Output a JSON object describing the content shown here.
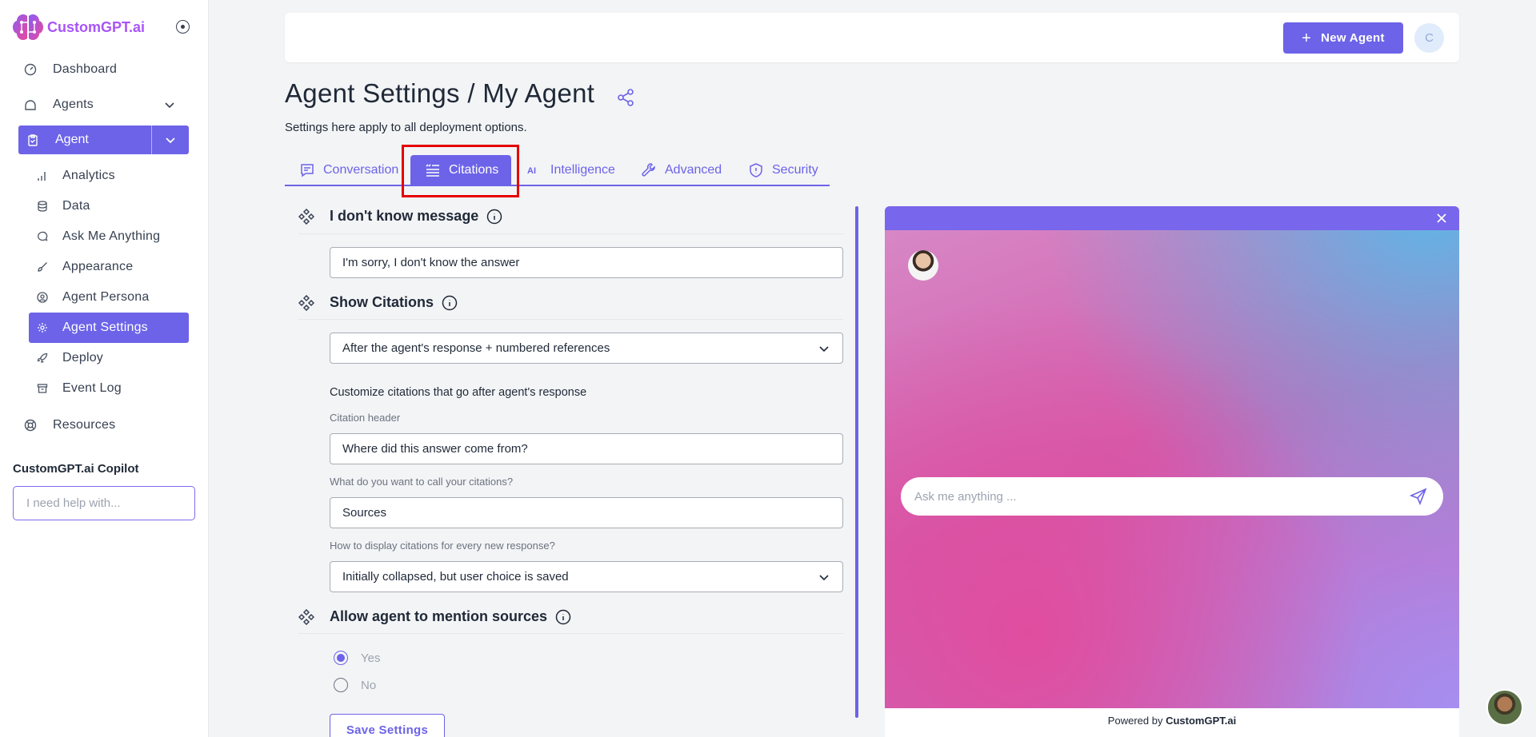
{
  "brand": {
    "name": "CustomGPT.ai",
    "accent": "#6c63e8"
  },
  "sidebar": {
    "items": [
      {
        "label": "Dashboard",
        "icon": "dashboard-icon"
      },
      {
        "label": "Agents",
        "icon": "home-icon"
      },
      {
        "label": "Agent",
        "icon": "clipboard-icon"
      }
    ],
    "sub_items": [
      {
        "label": "Analytics",
        "icon": "bar-chart-icon"
      },
      {
        "label": "Data",
        "icon": "database-icon"
      },
      {
        "label": "Ask Me Anything",
        "icon": "chat-icon"
      },
      {
        "label": "Appearance",
        "icon": "brush-icon"
      },
      {
        "label": "Agent Persona",
        "icon": "user-circle-icon"
      },
      {
        "label": "Agent Settings",
        "icon": "gear-icon",
        "active": true
      },
      {
        "label": "Deploy",
        "icon": "rocket-icon"
      },
      {
        "label": "Event Log",
        "icon": "archive-icon"
      }
    ],
    "resources": "Resources",
    "copilot": {
      "title": "CustomGPT.ai Copilot",
      "placeholder": "I need help with..."
    }
  },
  "header": {
    "new_agent": "New Agent",
    "avatar_initial": "C"
  },
  "page": {
    "title": "Agent Settings / My Agent",
    "subtitle": "Settings here apply to all deployment options."
  },
  "tabs": [
    {
      "label": "Conversation",
      "icon": "chat-icon"
    },
    {
      "label": "Citations",
      "icon": "list-quote-icon",
      "active": true
    },
    {
      "label": "Intelligence",
      "icon": "ai-icon"
    },
    {
      "label": "Advanced",
      "icon": "wrench-icon"
    },
    {
      "label": "Security",
      "icon": "shield-icon"
    }
  ],
  "form": {
    "idk": {
      "title": "I don't know message",
      "value": "I'm sorry, I don't know the answer"
    },
    "show_citations": {
      "title": "Show Citations",
      "value": "After the agent's response + numbered references"
    },
    "customize_label": "Customize citations that go after agent's response",
    "citation_header": {
      "label": "Citation header",
      "value": "Where did this answer come from?"
    },
    "citation_name": {
      "label": "What do you want to call your citations?",
      "value": "Sources"
    },
    "display": {
      "label": "How to display citations for every new response?",
      "value": "Initially collapsed, but user choice is saved"
    },
    "mention_sources": {
      "title": "Allow agent to mention sources",
      "options": [
        "Yes",
        "No"
      ],
      "selected": "Yes"
    },
    "save": "Save Settings"
  },
  "preview": {
    "placeholder": "Ask me anything ...",
    "powered_prefix": "Powered by",
    "powered_brand": "CustomGPT.ai"
  }
}
